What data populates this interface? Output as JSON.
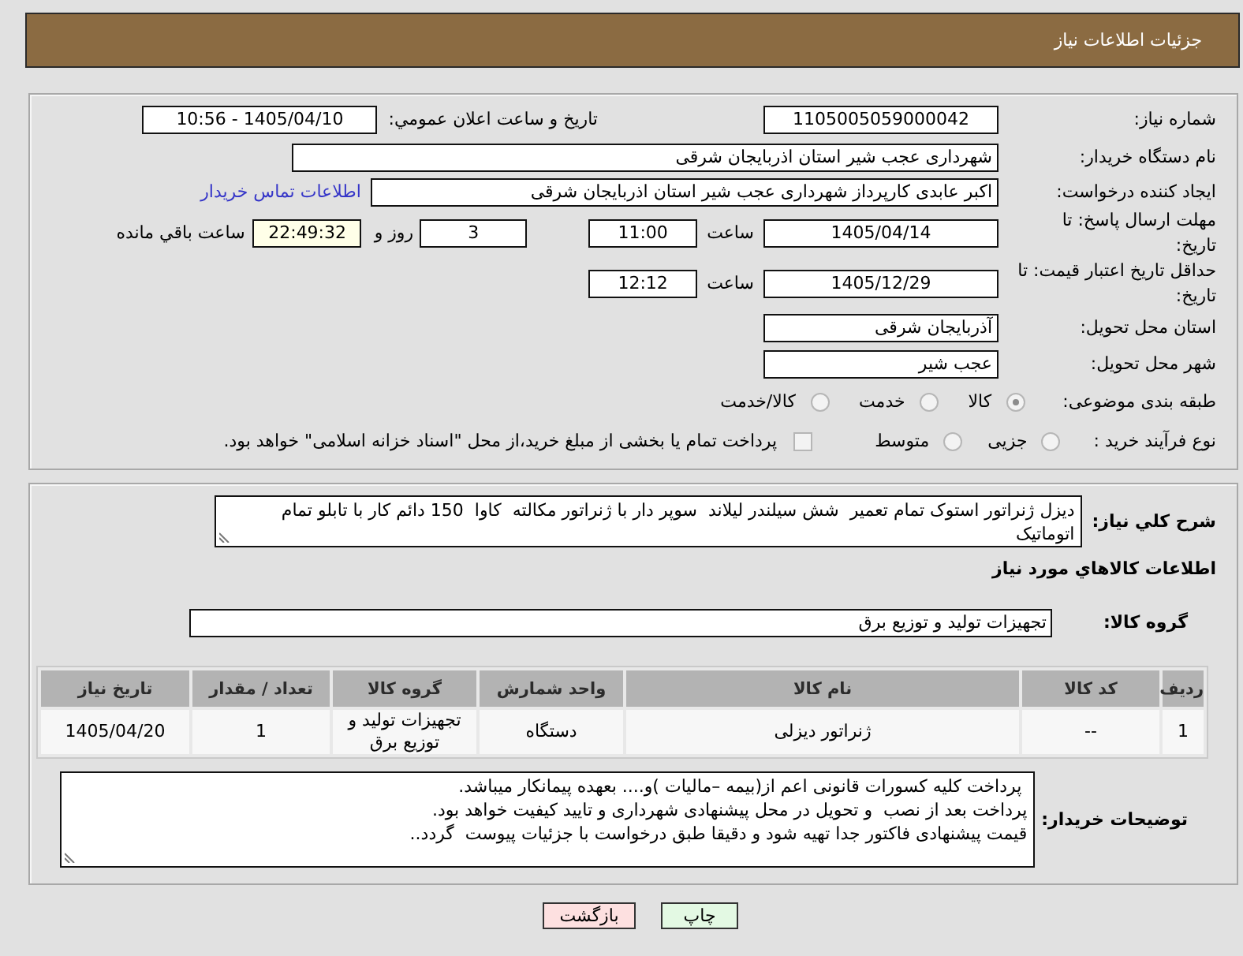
{
  "header": {
    "title": "جزئیات اطلاعات نیاز"
  },
  "request_info": {
    "need_number": {
      "label": "شماره نیاز:",
      "value": "1105005059000042"
    },
    "announce_datetime": {
      "label": "تاریخ و ساعت اعلان عمومي:",
      "value": "1405/04/10 - 10:56"
    },
    "buyer_org": {
      "label": "نام دستگاه خریدار:",
      "value": "شهرداری عجب شیر استان اذربایجان شرقی"
    },
    "requester": {
      "label": "ایجاد کننده درخواست:",
      "value": "اکبر عابدی کارپرداز شهرداری عجب شیر استان اذربایجان شرقی",
      "link": "اطلاعات تماس خریدار"
    },
    "reply_deadline": {
      "label": "مهلت ارسال پاسخ: تا تاریخ:",
      "date": "1405/04/14",
      "time_label": "ساعت",
      "time": "11:00",
      "days": "3",
      "days_label": "روز و",
      "remaining": "22:49:32",
      "remaining_label": "ساعت باقي مانده"
    },
    "price_validity": {
      "label": "حداقل تاریخ اعتبار قیمت: تا تاریخ:",
      "date": "1405/12/29",
      "time_label": "ساعت",
      "time": "12:12"
    },
    "delivery_province": {
      "label": "استان محل تحویل:",
      "value": "آذربایجان شرقی"
    },
    "delivery_city": {
      "label": "شهر محل تحویل:",
      "value": "عجب شیر"
    },
    "subject_category": {
      "label": "طبقه بندی موضوعی:",
      "options": [
        {
          "label": "کالا",
          "selected": true
        },
        {
          "label": "خدمت",
          "selected": false
        },
        {
          "label": "کالا/خدمت",
          "selected": false
        }
      ]
    },
    "purchase_type": {
      "label": "نوع فرآیند خرید :",
      "options": [
        {
          "label": "جزیی",
          "selected": false
        },
        {
          "label": "متوسط",
          "selected": false
        }
      ],
      "treasury_payment": {
        "label": "پرداخت تمام یا بخشی از مبلغ خرید،از محل \"اسناد خزانه اسلامی\" خواهد بود.",
        "checked": false
      }
    }
  },
  "description": {
    "label": "شرح کلي نیاز:",
    "value": "دیزل ژنراتور استوک تمام تعمیر  شش سیلندر لیلاند  سوپر دار با ژنراتور مکالته  کاوا  150 دائم کار با تابلو تمام اتوماتیک"
  },
  "goods": {
    "heading": "اطلاعات کالاهاي مورد نیاز",
    "group": {
      "label": "گروه کالا:",
      "value": "تجهیزات تولید و توزیع برق"
    },
    "table": {
      "columns": [
        "ردیف",
        "کد کالا",
        "نام کالا",
        "واحد شمارش",
        "گروه کالا",
        "تعداد / مقدار",
        "تاریخ نیاز"
      ],
      "rows": [
        [
          "1",
          "--",
          "ژنراتور دیزلی",
          "دستگاه",
          "تجهیزات تولید و توزیع برق",
          "1",
          "1405/04/20"
        ]
      ]
    }
  },
  "buyer_notes": {
    "label": "توضیحات خریدار:",
    "value": " پرداخت کلیه کسورات قانونی اعم از(بیمه –مالیات )و.... بعهده پیمانکار میباشد.\nپرداخت بعد از نصب  و تحویل در محل پیشنهادی شهرداری و تایید کیفیت خواهد بود.\nقیمت پیشنهادی فاکتور جدا تهیه شود و دقیقا طبق درخواست با جزئیات پیوست  گردد.."
  },
  "buttons": [
    {
      "label": "چاپ",
      "kind": "print"
    },
    {
      "label": "بازگشت",
      "kind": "back"
    }
  ]
}
